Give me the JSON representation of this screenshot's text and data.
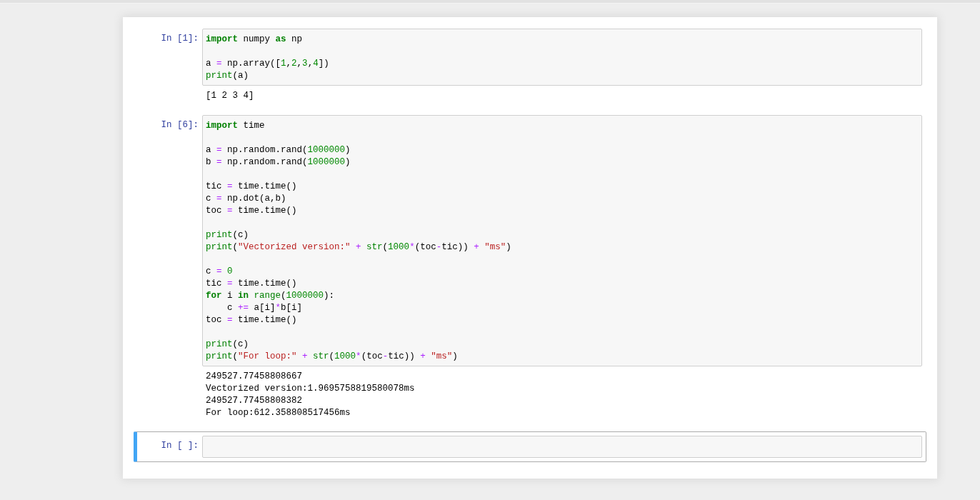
{
  "cells": [
    {
      "prompt": "In [1]:",
      "selected": false,
      "code_blocks": [
        [
          [
            {
              "kind": "keyword",
              "text": "import"
            },
            {
              "kind": "plain",
              "text": " numpy "
            },
            {
              "kind": "keyword",
              "text": "as"
            },
            {
              "kind": "plain",
              "text": " np"
            }
          ]
        ],
        [
          [
            {
              "kind": "plain",
              "text": "a "
            },
            {
              "kind": "operator",
              "text": "="
            },
            {
              "kind": "plain",
              "text": " np.array(["
            },
            {
              "kind": "number",
              "text": "1"
            },
            {
              "kind": "plain",
              "text": ","
            },
            {
              "kind": "number",
              "text": "2"
            },
            {
              "kind": "plain",
              "text": ","
            },
            {
              "kind": "number",
              "text": "3"
            },
            {
              "kind": "plain",
              "text": ","
            },
            {
              "kind": "number",
              "text": "4"
            },
            {
              "kind": "plain",
              "text": "])"
            }
          ],
          [
            {
              "kind": "builtin",
              "text": "print"
            },
            {
              "kind": "plain",
              "text": "(a)"
            }
          ]
        ]
      ],
      "outputs": [
        "[1 2 3 4]"
      ]
    },
    {
      "prompt": "In [6]:",
      "selected": false,
      "code_blocks": [
        [
          [
            {
              "kind": "keyword",
              "text": "import"
            },
            {
              "kind": "plain",
              "text": " time"
            }
          ]
        ],
        [
          [
            {
              "kind": "plain",
              "text": "a "
            },
            {
              "kind": "operator",
              "text": "="
            },
            {
              "kind": "plain",
              "text": " np.random.rand("
            },
            {
              "kind": "number",
              "text": "1000000"
            },
            {
              "kind": "plain",
              "text": ")"
            }
          ],
          [
            {
              "kind": "plain",
              "text": "b "
            },
            {
              "kind": "operator",
              "text": "="
            },
            {
              "kind": "plain",
              "text": " np.random.rand("
            },
            {
              "kind": "number",
              "text": "1000000"
            },
            {
              "kind": "plain",
              "text": ")"
            }
          ]
        ],
        [
          [
            {
              "kind": "plain",
              "text": "tic "
            },
            {
              "kind": "operator",
              "text": "="
            },
            {
              "kind": "plain",
              "text": " time.time()"
            }
          ],
          [
            {
              "kind": "plain",
              "text": "c "
            },
            {
              "kind": "operator",
              "text": "="
            },
            {
              "kind": "plain",
              "text": " np.dot(a,b)"
            }
          ],
          [
            {
              "kind": "plain",
              "text": "toc "
            },
            {
              "kind": "operator",
              "text": "="
            },
            {
              "kind": "plain",
              "text": " time.time()"
            }
          ]
        ],
        [
          [
            {
              "kind": "builtin",
              "text": "print"
            },
            {
              "kind": "plain",
              "text": "(c)"
            }
          ],
          [
            {
              "kind": "builtin",
              "text": "print"
            },
            {
              "kind": "plain",
              "text": "("
            },
            {
              "kind": "string",
              "text": "\"Vectorized version:\""
            },
            {
              "kind": "operator",
              "text": " +"
            },
            {
              "kind": "builtin",
              "text": " str"
            },
            {
              "kind": "plain",
              "text": "("
            },
            {
              "kind": "number",
              "text": "1000"
            },
            {
              "kind": "operator",
              "text": "*"
            },
            {
              "kind": "plain",
              "text": "(toc"
            },
            {
              "kind": "operator",
              "text": "-"
            },
            {
              "kind": "plain",
              "text": "tic)) "
            },
            {
              "kind": "operator",
              "text": "+"
            },
            {
              "kind": "string",
              "text": " \"ms\""
            },
            {
              "kind": "plain",
              "text": ")"
            }
          ]
        ],
        [
          [
            {
              "kind": "plain",
              "text": "c "
            },
            {
              "kind": "operator",
              "text": "="
            },
            {
              "kind": "number",
              "text": " 0"
            }
          ],
          [
            {
              "kind": "plain",
              "text": "tic "
            },
            {
              "kind": "operator",
              "text": "="
            },
            {
              "kind": "plain",
              "text": " time.time()"
            }
          ],
          [
            {
              "kind": "keyword",
              "text": "for"
            },
            {
              "kind": "plain",
              "text": " i "
            },
            {
              "kind": "keyword",
              "text": "in"
            },
            {
              "kind": "builtin",
              "text": " range"
            },
            {
              "kind": "plain",
              "text": "("
            },
            {
              "kind": "number",
              "text": "1000000"
            },
            {
              "kind": "plain",
              "text": "):"
            }
          ],
          [
            {
              "kind": "plain",
              "text": "    c "
            },
            {
              "kind": "operator",
              "text": "+="
            },
            {
              "kind": "plain",
              "text": " a[i]"
            },
            {
              "kind": "operator",
              "text": "*"
            },
            {
              "kind": "plain",
              "text": "b[i]"
            }
          ],
          [
            {
              "kind": "plain",
              "text": "toc "
            },
            {
              "kind": "operator",
              "text": "="
            },
            {
              "kind": "plain",
              "text": " time.time()"
            }
          ]
        ],
        [
          [
            {
              "kind": "builtin",
              "text": "print"
            },
            {
              "kind": "plain",
              "text": "(c)"
            }
          ],
          [
            {
              "kind": "builtin",
              "text": "print"
            },
            {
              "kind": "plain",
              "text": "("
            },
            {
              "kind": "string",
              "text": "\"For loop:\""
            },
            {
              "kind": "operator",
              "text": " +"
            },
            {
              "kind": "builtin",
              "text": " str"
            },
            {
              "kind": "plain",
              "text": "("
            },
            {
              "kind": "number",
              "text": "1000"
            },
            {
              "kind": "operator",
              "text": "*"
            },
            {
              "kind": "plain",
              "text": "(toc"
            },
            {
              "kind": "operator",
              "text": "-"
            },
            {
              "kind": "plain",
              "text": "tic)) "
            },
            {
              "kind": "operator",
              "text": "+"
            },
            {
              "kind": "string",
              "text": " \"ms\""
            },
            {
              "kind": "plain",
              "text": ")"
            }
          ]
        ]
      ],
      "outputs": [
        "249527.77458808667",
        "Vectorized version:1.9695758819580078ms",
        "249527.77458808382",
        "For loop:612.358808517456ms"
      ]
    },
    {
      "prompt": "In [ ]:",
      "selected": true
    }
  ]
}
